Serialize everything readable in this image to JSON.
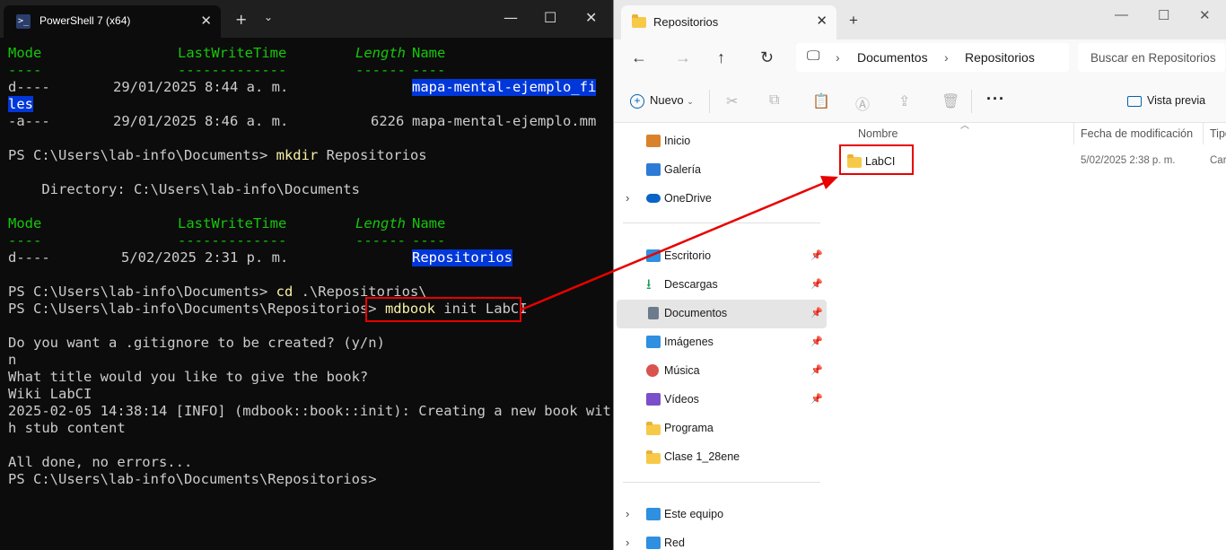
{
  "terminal": {
    "tab_title": "PowerShell 7 (x64)",
    "tab_icon": "terminal-icon",
    "listing1": {
      "header": {
        "mode": "Mode",
        "lwt": "LastWriteTime",
        "length": "Length",
        "name": "Name"
      },
      "underline": {
        "mode": "----",
        "lwt": "-------------",
        "length": "------",
        "name": "----"
      },
      "rows": [
        {
          "mode": "d----",
          "date": "29/01/2025",
          "time": "8:44 a. m.",
          "length": "",
          "name_part1": "mapa-mental-ejemplo_fi",
          "name_part2": "les"
        },
        {
          "mode": "-a---",
          "date": "29/01/2025",
          "time": "8:46 a. m.",
          "length": "6226",
          "name": "mapa-mental-ejemplo.mm"
        }
      ]
    },
    "cmd1": {
      "prompt": "PS C:\\Users\\lab-info\\Documents> ",
      "command": "mkdir",
      "args": " Repositorios"
    },
    "directory_line": "    Directory: C:\\Users\\lab-info\\Documents",
    "listing2": {
      "rows": [
        {
          "mode": "d----",
          "date": "5/02/2025",
          "time": "2:31 p. m.",
          "name": "Repositorios"
        }
      ]
    },
    "cmd2": {
      "prompt": "PS C:\\Users\\lab-info\\Documents> ",
      "command": "cd",
      "args": " .\\Repositorios\\"
    },
    "cmd3": {
      "prompt": "PS C:\\Users\\lab-info\\Documents\\Repositorios> ",
      "command": "mdbook",
      "args": " init LabCI"
    },
    "output": [
      "Do you want a .gitignore to be created? (y/n)",
      "n",
      "What title would you like to give the book?",
      "Wiki LabCI",
      "2025-02-05 14:38:14 [INFO] (mdbook::book::init): Creating a new book wit",
      "h stub content",
      "",
      "All done, no errors...",
      "PS C:\\Users\\lab-info\\Documents\\Repositorios>"
    ]
  },
  "explorer": {
    "tab_title": "Repositorios",
    "breadcrumb": [
      "Documentos",
      "Repositorios"
    ],
    "search_placeholder": "Buscar en Repositorios",
    "toolbar": {
      "new_label": "Nuevo",
      "preview_label": "Vista previa"
    },
    "nav": [
      {
        "label": "Inicio",
        "icon": "home-icon",
        "color": "#d9822b"
      },
      {
        "label": "Galería",
        "icon": "gallery-icon",
        "color": "#2d7bd6"
      },
      {
        "label": "OneDrive",
        "icon": "cloud-icon",
        "color": "#0a64c8"
      },
      {
        "label": "Escritorio",
        "icon": "desktop-icon",
        "color": "#2f8fe0"
      },
      {
        "label": "Descargas",
        "icon": "download-icon",
        "color": "#1f9d55"
      },
      {
        "label": "Documentos",
        "icon": "documents-icon",
        "color": "#6d7c8c"
      },
      {
        "label": "Imágenes",
        "icon": "pictures-icon",
        "color": "#2f8fe0"
      },
      {
        "label": "Música",
        "icon": "music-icon",
        "color": "#d9534f"
      },
      {
        "label": "Vídeos",
        "icon": "videos-icon",
        "color": "#7b4fc9"
      },
      {
        "label": "Programa",
        "icon": "folder-icon",
        "color": "#f7c948"
      },
      {
        "label": "Clase 1_28ene",
        "icon": "folder-icon",
        "color": "#f7c948"
      },
      {
        "label": "Este equipo",
        "icon": "computer-icon",
        "color": "#2f8fe0"
      },
      {
        "label": "Red",
        "icon": "network-icon",
        "color": "#2f8fe0"
      }
    ],
    "columns": {
      "name": "Nombre",
      "modified": "Fecha de modificación",
      "type": "Tipo"
    },
    "files": [
      {
        "name": "LabCI",
        "modified": "5/02/2025 2:38 p. m.",
        "type": "Car"
      }
    ]
  },
  "annotation": {
    "color": "#e80000"
  }
}
